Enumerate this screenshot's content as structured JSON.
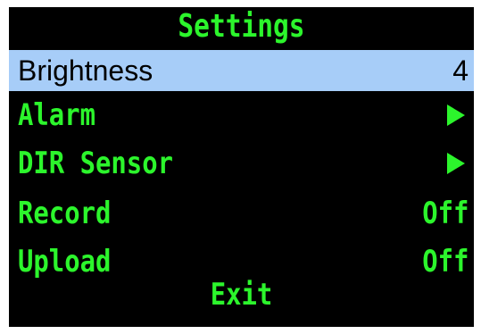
{
  "screen": {
    "title": "Settings",
    "items": [
      {
        "label": "Brightness",
        "value": "4",
        "selected": true
      },
      {
        "label": "Alarm",
        "icon": "play-arrow-icon"
      },
      {
        "label": "DIR Sensor",
        "icon": "play-arrow-icon"
      },
      {
        "label": "Record",
        "value": "Off"
      },
      {
        "label": "Upload",
        "value": "Off"
      }
    ],
    "exit_label": "Exit"
  },
  "colors": {
    "background": "#000000",
    "text": "#2cf52c",
    "highlight": "#a7cdf8",
    "highlight_text": "#000000"
  }
}
